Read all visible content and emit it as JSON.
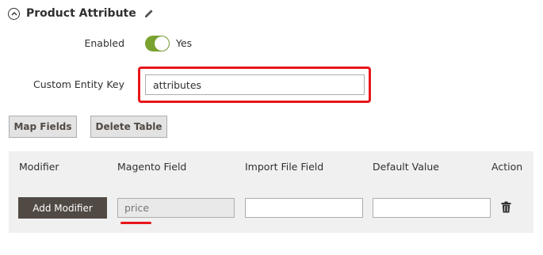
{
  "section": {
    "title": "Product Attribute",
    "collapse_icon": "circle-chevron-up-icon",
    "edit_icon": "pencil-icon"
  },
  "enabled": {
    "label": "Enabled",
    "value_text": "Yes",
    "on": true,
    "color": "#79a22e"
  },
  "custom_entity_key": {
    "label": "Custom Entity Key",
    "value": "attributes",
    "highlight_color": "#e8161b"
  },
  "buttons": {
    "map_fields": "Map Fields",
    "delete_table": "Delete Table"
  },
  "grid": {
    "headers": {
      "modifier": "Modifier",
      "magento_field": "Magento Field",
      "import_file_field": "Import File Field",
      "default_value": "Default Value",
      "action": "Action"
    },
    "row": {
      "add_modifier": "Add Modifier",
      "magento_field_value": "price",
      "import_file_field_value": "",
      "default_value_value": "",
      "action_icon": "trash-icon"
    }
  }
}
